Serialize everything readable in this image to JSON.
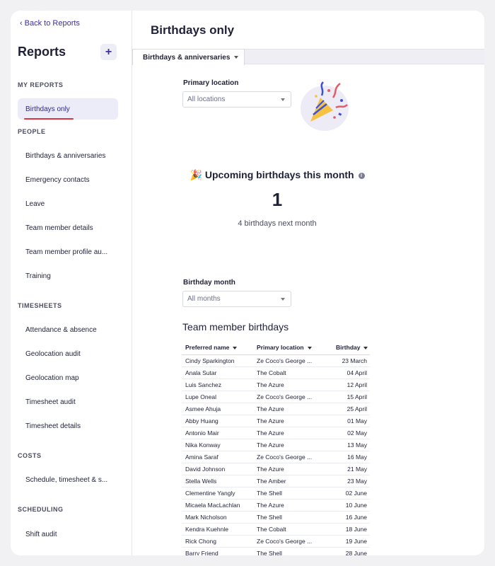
{
  "sidebar": {
    "back_label": "Back to Reports",
    "title": "Reports",
    "add_label": "+",
    "sections": [
      {
        "label": "MY REPORTS",
        "items": [
          "Birthdays only"
        ]
      },
      {
        "label": "PEOPLE",
        "items": [
          "Birthdays & anniversaries",
          "Emergency contacts",
          "Leave",
          "Team member details",
          "Team member profile au...",
          "Training"
        ]
      },
      {
        "label": "TIMESHEETS",
        "items": [
          "Attendance & absence",
          "Geolocation audit",
          "Geolocation map",
          "Timesheet audit",
          "Timesheet details"
        ]
      },
      {
        "label": "COSTS",
        "items": [
          "Schedule, timesheet & s..."
        ]
      },
      {
        "label": "SCHEDULING",
        "items": [
          "Shift audit"
        ]
      }
    ],
    "active_item": "Birthdays only"
  },
  "main": {
    "page_title": "Birthdays only",
    "tab_label": "Birthdays & anniversaries",
    "primary_location_label": "Primary location",
    "primary_location_value": "All locations",
    "upcoming_emoji": "🎉",
    "upcoming_title": "Upcoming birthdays this month",
    "upcoming_count": "1",
    "next_month_text": "4  birthdays next month",
    "birthday_month_label": "Birthday month",
    "birthday_month_value": "All months",
    "table_title": "Team member birthdays",
    "columns": [
      "Preferred name",
      "Primary location",
      "Birthday"
    ],
    "rows": [
      [
        "Cindy Sparkington",
        "Ze Coco's George ...",
        "23 March"
      ],
      [
        "Anala Sutar",
        "The Cobalt",
        "04 April"
      ],
      [
        "Luis Sanchez",
        "The Azure",
        "12 April"
      ],
      [
        "Lupe Oneal",
        "Ze Coco's George ...",
        "15 April"
      ],
      [
        "Asmee Ahuja",
        "The Azure",
        "25 April"
      ],
      [
        "Abby Huang",
        "The Azure",
        "01 May"
      ],
      [
        "Antonio Mair",
        "The Azure",
        "02 May"
      ],
      [
        "Nika Konway",
        "The Azure",
        "13 May"
      ],
      [
        "Amina Saraf",
        "Ze Coco's George ...",
        "16 May"
      ],
      [
        "David Johnson",
        "The Azure",
        "21 May"
      ],
      [
        "Stella Wells",
        "The Amber",
        "23 May"
      ],
      [
        "Clementine Yangly",
        "The Shell",
        "02 June"
      ],
      [
        "Micaela MacLachlan",
        "The Azure",
        "10 June"
      ],
      [
        "Mark Nicholson",
        "The Shell",
        "16 June"
      ],
      [
        "Kendra Kuehnle",
        "The Cobalt",
        "18 June"
      ],
      [
        "Rick Chong",
        "Ze Coco's George ...",
        "19 June"
      ],
      [
        "Barry Friend",
        "The Shell",
        "28 June"
      ]
    ]
  },
  "colors": {
    "accent": "#3a2f9b",
    "active_bg": "#ecebf8",
    "underline_red": "#e0323c"
  }
}
